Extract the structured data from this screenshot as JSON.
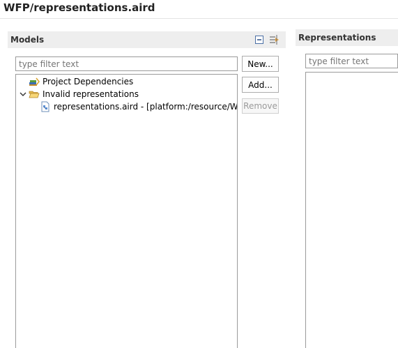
{
  "title": "WFP/representations.aird",
  "models": {
    "header": "Models",
    "filter_placeholder": "type filter text",
    "tree": [
      {
        "label": "Project Dependencies",
        "icon": "project-dependencies-icon"
      },
      {
        "label": "Invalid representations",
        "icon": "folder-open-icon",
        "expanded": true
      },
      {
        "label": "representations.aird - [platform:/resource/WFP/re",
        "icon": "aird-file-icon"
      }
    ],
    "buttons": {
      "new": "New...",
      "add": "Add...",
      "remove": "Remove"
    }
  },
  "representations": {
    "header": "Representations",
    "filter_placeholder": "type filter text"
  }
}
